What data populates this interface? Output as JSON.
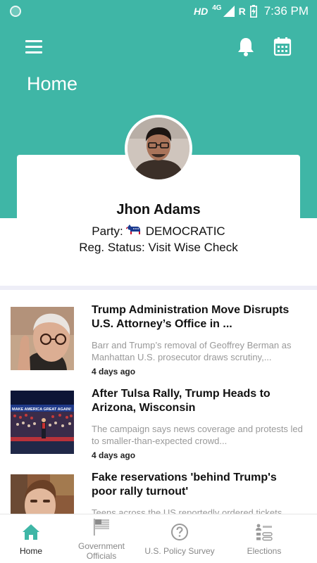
{
  "status_bar": {
    "hd": "HD",
    "network": "4G",
    "roaming": "R",
    "time": "7:36 PM"
  },
  "header": {
    "title": "Home",
    "background": "#3fb6a6",
    "icons": [
      "menu-icon",
      "bell-icon",
      "calendar-icon"
    ]
  },
  "profile": {
    "name": "Jhon Adams",
    "party_label": "Party:",
    "party_value": "DEMOCRATIC",
    "reg_label": "Reg. Status:",
    "reg_value": "Visit Wise Check"
  },
  "news": [
    {
      "title": "Trump Administration Move Disrupts U.S. Attorney’s Office in ...",
      "description": "Barr and Trump’s removal of Geoffrey Berman as Manhattan U.S. prosecutor draws scrutiny,...",
      "time": "4 days ago"
    },
    {
      "title": "After Tulsa Rally, Trump Heads to Arizona, Wisconsin",
      "description": "The campaign says news coverage and protests led to smaller-than-expected crowd...",
      "time": "4 days ago",
      "banner_text": "MAKE AMERICA GREAT AGAIN!"
    },
    {
      "title": "Fake reservations 'behind Trump's poor rally turnout'",
      "description": "Teens across the US reportedly ordered tickets",
      "time": ""
    }
  ],
  "bottom_nav": {
    "items": [
      {
        "label": "Home",
        "icon": "home-icon",
        "active": true
      },
      {
        "label": "Government Officials",
        "icon": "flag-icon",
        "active": false
      },
      {
        "label": "U.S. Policy Survey",
        "icon": "question-icon",
        "active": false
      },
      {
        "label": "Elections",
        "icon": "ballot-list-icon",
        "active": false
      }
    ],
    "active_color": "#3fb6a6",
    "inactive_color": "#9a9a9a"
  }
}
